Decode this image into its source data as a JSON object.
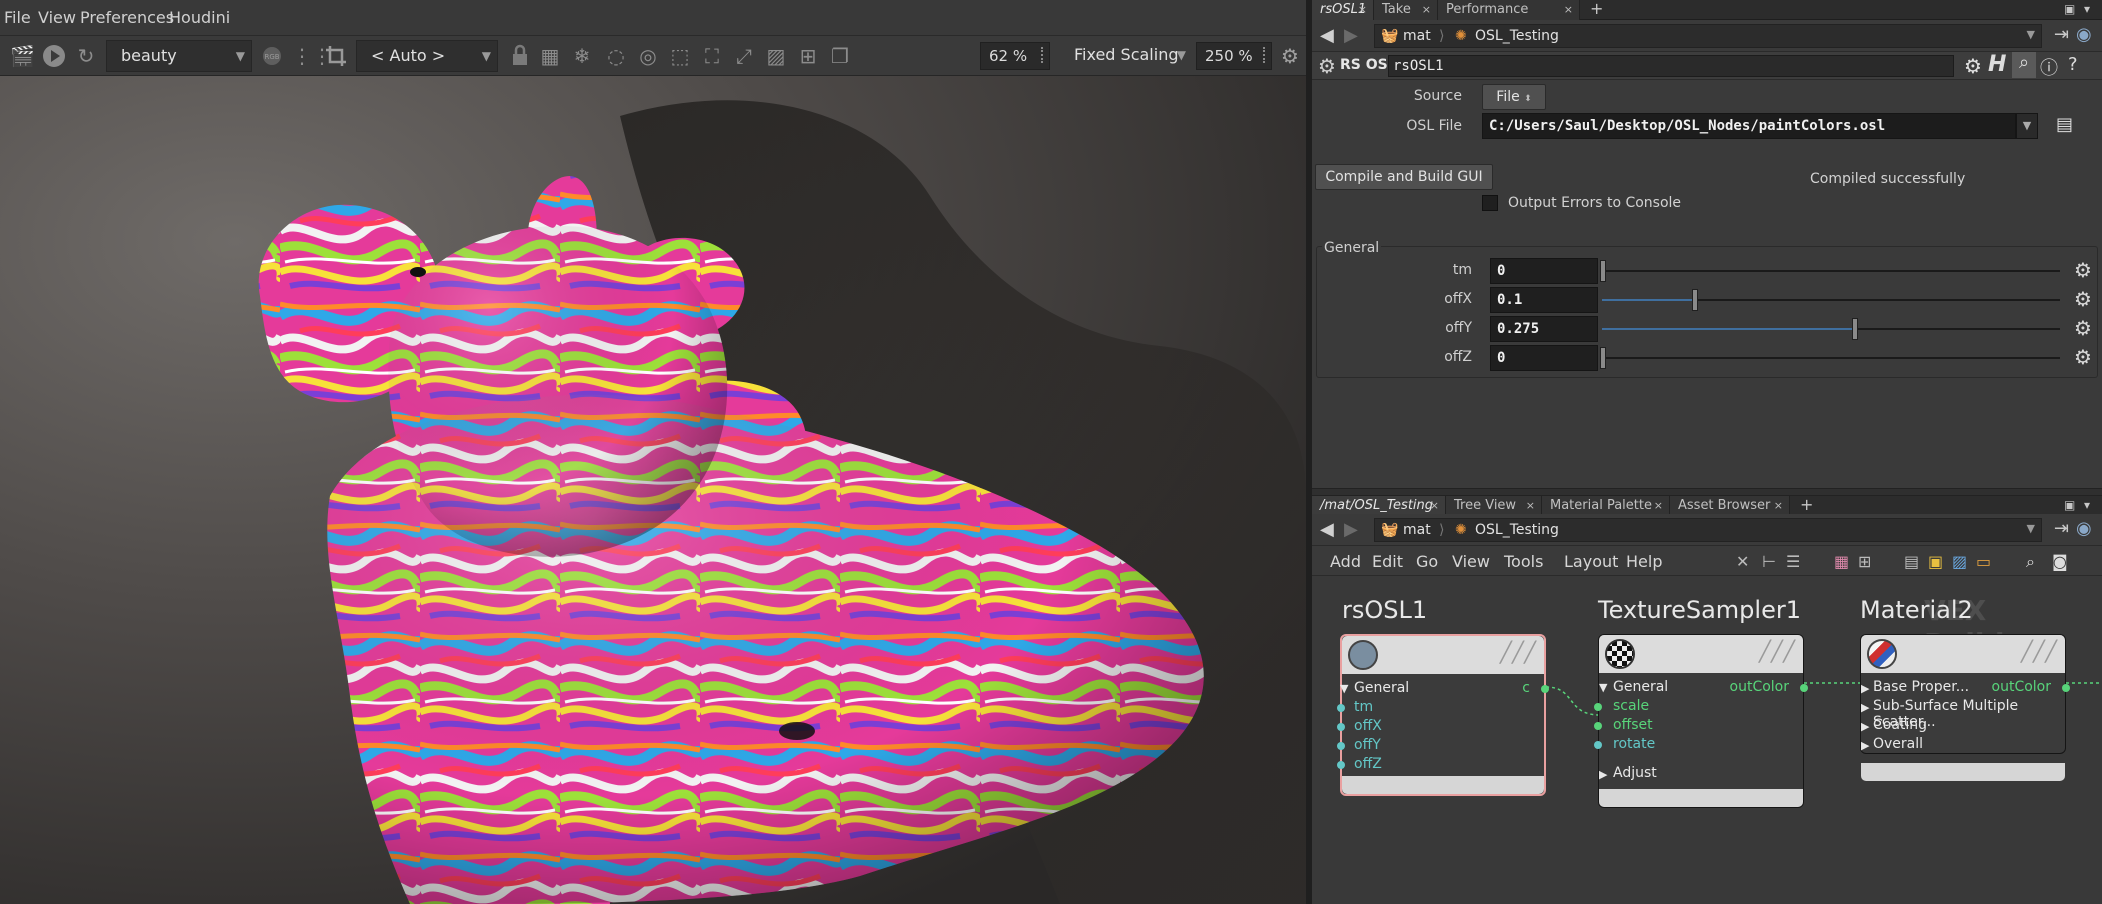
{
  "menubar": {
    "items": [
      "File",
      "View",
      "Preferences",
      "Houdini"
    ]
  },
  "viewer_toolbar": {
    "aov": "beauty",
    "camera": "< Auto >",
    "zoom": "62 %",
    "scaling": "Fixed Scaling",
    "scale_pct": "250 %",
    "rgb_badge": "RGB"
  },
  "param_tabs": {
    "tabs": [
      {
        "label": "rsOSL1",
        "active": true
      },
      {
        "label": "Take List",
        "active": false
      },
      {
        "label": "Performance Monitor",
        "active": false
      }
    ],
    "close_glyph": "×",
    "plus_glyph": "+"
  },
  "param_path": {
    "root": "mat",
    "node": "OSL_Testing"
  },
  "node_header": {
    "type_label": "RS OSL",
    "name": "rsOSL1"
  },
  "source": {
    "label": "Source",
    "value": "File"
  },
  "osl_file": {
    "label": "OSL File",
    "value": "C:/Users/Saul/Desktop/OSL_Nodes/paintColors.osl"
  },
  "compile": {
    "button": "Compile and Build GUI",
    "status": "Compiled successfully"
  },
  "output_errors": {
    "label": "Output Errors to Console",
    "checked": false
  },
  "general": {
    "title": "General",
    "params": [
      {
        "label": "tm",
        "value": "0",
        "fraction": 0.0
      },
      {
        "label": "offX",
        "value": "0.1",
        "fraction": 0.2
      },
      {
        "label": "offY",
        "value": "0.275",
        "fraction": 0.55
      },
      {
        "label": "offZ",
        "value": "0",
        "fraction": 0.0
      }
    ]
  },
  "net_tabs": {
    "tabs": [
      {
        "label": "/mat/OSL_Testing",
        "active": true
      },
      {
        "label": "Tree View",
        "active": false
      },
      {
        "label": "Material Palette",
        "active": false
      },
      {
        "label": "Asset Browser",
        "active": false
      }
    ]
  },
  "net_path": {
    "root": "mat",
    "node": "OSL_Testing"
  },
  "net_menu": {
    "items": [
      "Add",
      "Edit",
      "Go",
      "View",
      "Tools",
      "Layout",
      "Help"
    ]
  },
  "network": {
    "watermark": "VEX Builder",
    "nodes": [
      {
        "title": "rsOSL1",
        "header_row": "General",
        "out_port": "c",
        "inputs": [
          "tm",
          "offX",
          "offY",
          "offZ"
        ]
      },
      {
        "title": "TextureSampler1",
        "header_row": "General",
        "out_port": "outColor",
        "inputs": [
          "scale",
          "offset",
          "rotate"
        ],
        "extra_row": "Adjust"
      },
      {
        "title": "Material2",
        "rows": [
          "Base Proper...",
          "Sub-Surface Multiple Scatter...",
          "Coating",
          "Overall"
        ],
        "out_port": "outColor"
      }
    ]
  },
  "colors": {
    "accent_blue": "#3f6f9f",
    "port_cyan": "#63c7c7",
    "port_green": "#58d47a",
    "selected_outline": "#e9a0a0"
  }
}
